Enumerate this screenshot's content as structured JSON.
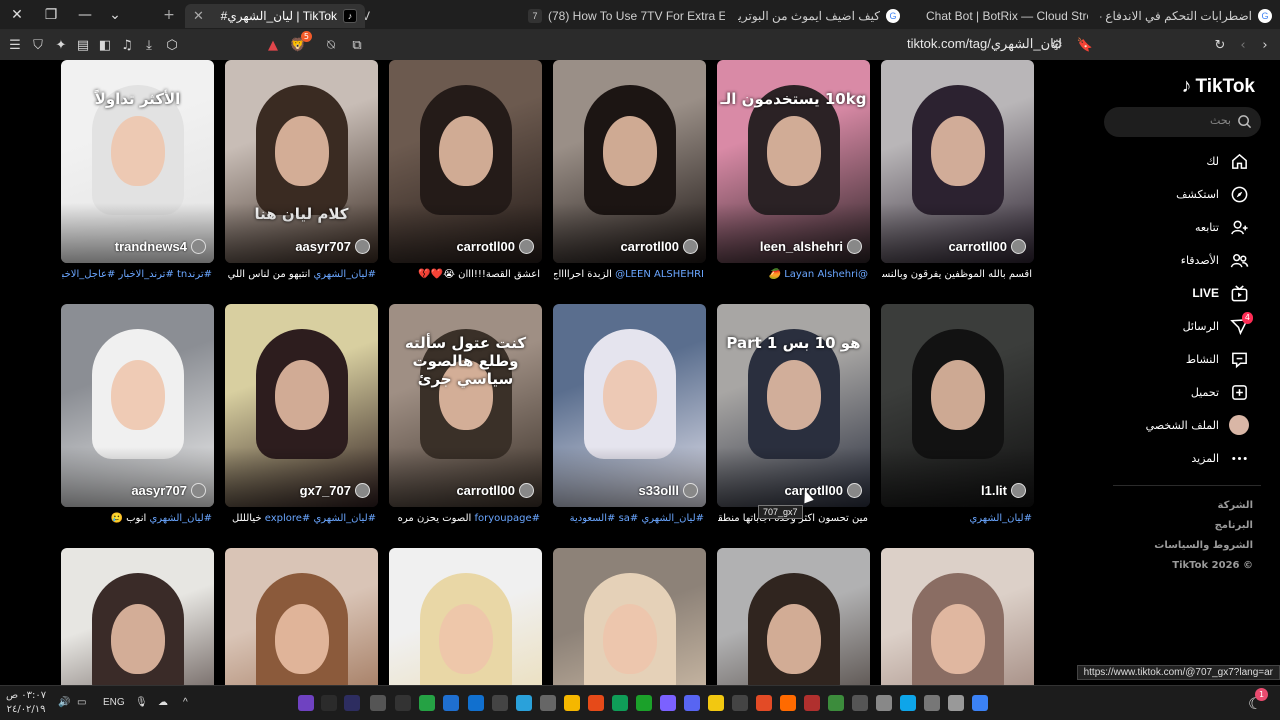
{
  "window": {
    "tabs": [
      {
        "title": "7TV",
        "favicon": "7tv-icon"
      },
      {
        "title": "#ليان_الشهري | TikTok",
        "favicon": "tiktok-icon"
      },
      {
        "title": "(78) How To Use 7TV For Extra Emote",
        "favicon": "youtube-icon"
      },
      {
        "title": "كيف اضيف ايموث من البوتريكس - بحث",
        "favicon": "google-icon"
      },
      {
        "title": "Chat Bot | BotRix — Cloud Streaming",
        "favicon": "botrix-icon"
      },
      {
        "title": "اضطرابات التحكم في الاندفاع - بحث",
        "favicon": "google-icon"
      }
    ]
  },
  "toolbar": {
    "url": "tiktok.com/tag/ليان_الشهري",
    "brave_badge": "5"
  },
  "grid": {
    "cards": [
      {
        "author": "carrotll00",
        "caption_plain": "اقسم بالله الموظفين يفرقون وبالنسبه لي",
        "caption_tags": "",
        "overlay": "",
        "colors": [
          "#b9b6b8",
          "#2c2230"
        ]
      },
      {
        "author": "leen_alshehri",
        "caption_plain": "",
        "caption_tags": "@Layan Alshehri",
        "caption_emoji": "🥭",
        "overlay": "10kg يستخدمون الـ",
        "colors": [
          "#d98aa6",
          "#2b2225"
        ]
      },
      {
        "author": "carrotll00",
        "caption_plain": "الزبدة احرااااج",
        "caption_tags": "LEEN ALSHEHRI@",
        "overlay": "",
        "colors": [
          "#9a8f87",
          "#1c1513"
        ]
      },
      {
        "author": "carrotll00",
        "caption_plain": "اعشق القصة!!!ااان",
        "caption_tags": "",
        "caption_emoji": "😭❤️💔",
        "overlay": "",
        "colors": [
          "#6c5a4f",
          "#241b18"
        ]
      },
      {
        "author": "aasyr707",
        "caption_plain": "انتبهو من لناس اللي كذا!!",
        "caption_tags": "#ليان_الشهري",
        "overlay": "كلام ليان هنا",
        "colors": [
          "#c8bdb6",
          "#3a2b22"
        ]
      },
      {
        "author": "trandnews4",
        "caption_plain": "",
        "caption_tags": "#ترندtn #ترند_الاخبار #عاجل_الاخبار",
        "overlay": "الأكثر تداولاً",
        "colors": [
          "#f1f1f1",
          "#e2e2e2"
        ]
      },
      {
        "author": "l1.lit",
        "caption_plain": "",
        "caption_tags": "#ليان_الشهري",
        "overlay": "",
        "colors": [
          "#3b3d3b",
          "#121212"
        ]
      },
      {
        "author": "carrotll00",
        "caption_plain": "مين تحسون اكثر وحده اجاباتها منطقية ؟!",
        "caption_tags": "",
        "overlay": "هو 10 بس Part 1",
        "colors": [
          "#a8a6a4",
          "#2a2f3e"
        ]
      },
      {
        "author": "s33olll",
        "caption_plain": "",
        "caption_tags": "#ليان_الشهري #sa #السعودية",
        "overlay": "",
        "colors": [
          "#5a6e8e",
          "#e5e4ee"
        ]
      },
      {
        "author": "carrotll00",
        "caption_plain": "الصوت يحزن مره",
        "caption_tags": "#foryoupage",
        "overlay": "كنت عتول سألته وطلع هالصوت سياسي جرئ",
        "colors": [
          "#9f8f84",
          "#3a3028"
        ]
      },
      {
        "author": "gx7_707",
        "caption_plain": "خيالللل",
        "caption_tags": "#ليان_الشهري #explore",
        "overlay": "",
        "colors": [
          "#d8cfa0",
          "#2d1d1e"
        ]
      },
      {
        "author": "aasyr707",
        "caption_plain": "انوب",
        "caption_tags": "#ليان_الشهري",
        "caption_emoji": "🥲",
        "overlay": "",
        "colors": [
          "#8b8e94",
          "#f0f0f0"
        ]
      },
      {
        "author": "",
        "caption_plain": "",
        "caption_tags": "",
        "overlay": "",
        "colors": [
          "#dcd0c8",
          "#8a6d63"
        ]
      },
      {
        "author": "",
        "caption_plain": "",
        "caption_tags": "",
        "overlay": "",
        "colors": [
          "#b1b1b2",
          "#30251f"
        ]
      },
      {
        "author": "",
        "caption_plain": "",
        "caption_tags": "",
        "overlay": "",
        "colors": [
          "#8d8278",
          "#e5d1b8"
        ]
      },
      {
        "author": "",
        "caption_plain": "",
        "caption_tags": "",
        "overlay": "",
        "colors": [
          "#f0f0f0",
          "#e9d7a6"
        ]
      },
      {
        "author": "",
        "caption_plain": "",
        "caption_tags": "",
        "overlay": "",
        "colors": [
          "#d9c4b6",
          "#8b5a3b"
        ]
      },
      {
        "author": "",
        "caption_plain": "",
        "caption_tags": "",
        "overlay": "",
        "colors": [
          "#e7e6e2",
          "#3a2b28"
        ]
      }
    ],
    "tooltip": "707_gx7"
  },
  "sidebar": {
    "logo": "TikTok",
    "search_placeholder": "بحث",
    "nav": [
      {
        "label": "لك",
        "icon": "home-icon"
      },
      {
        "label": "استكشف",
        "icon": "compass-icon"
      },
      {
        "label": "تتابعه",
        "icon": "following-icon"
      },
      {
        "label": "الأصدقاء",
        "icon": "friends-icon"
      },
      {
        "label": "LIVE",
        "icon": "live-icon"
      },
      {
        "label": "الرسائل",
        "icon": "messages-icon",
        "badge": "4"
      },
      {
        "label": "النشاط",
        "icon": "activity-icon"
      },
      {
        "label": "تحميل",
        "icon": "upload-icon"
      },
      {
        "label": "الملف الشخصي",
        "icon": "profile-avatar"
      },
      {
        "label": "المزيد",
        "icon": "more-icon"
      }
    ],
    "footer": [
      "الشركة",
      "البرنامج",
      "الشروط والسياسات",
      "© TikTok 2026"
    ]
  },
  "status_url": "https://www.tiktok.com/@707_gx7?lang=ar",
  "taskbar": {
    "time": "٠٣:٠٧ ص",
    "date": "٢٤/٠٢/١٩",
    "lang": "ENG",
    "notif_count": "1"
  }
}
